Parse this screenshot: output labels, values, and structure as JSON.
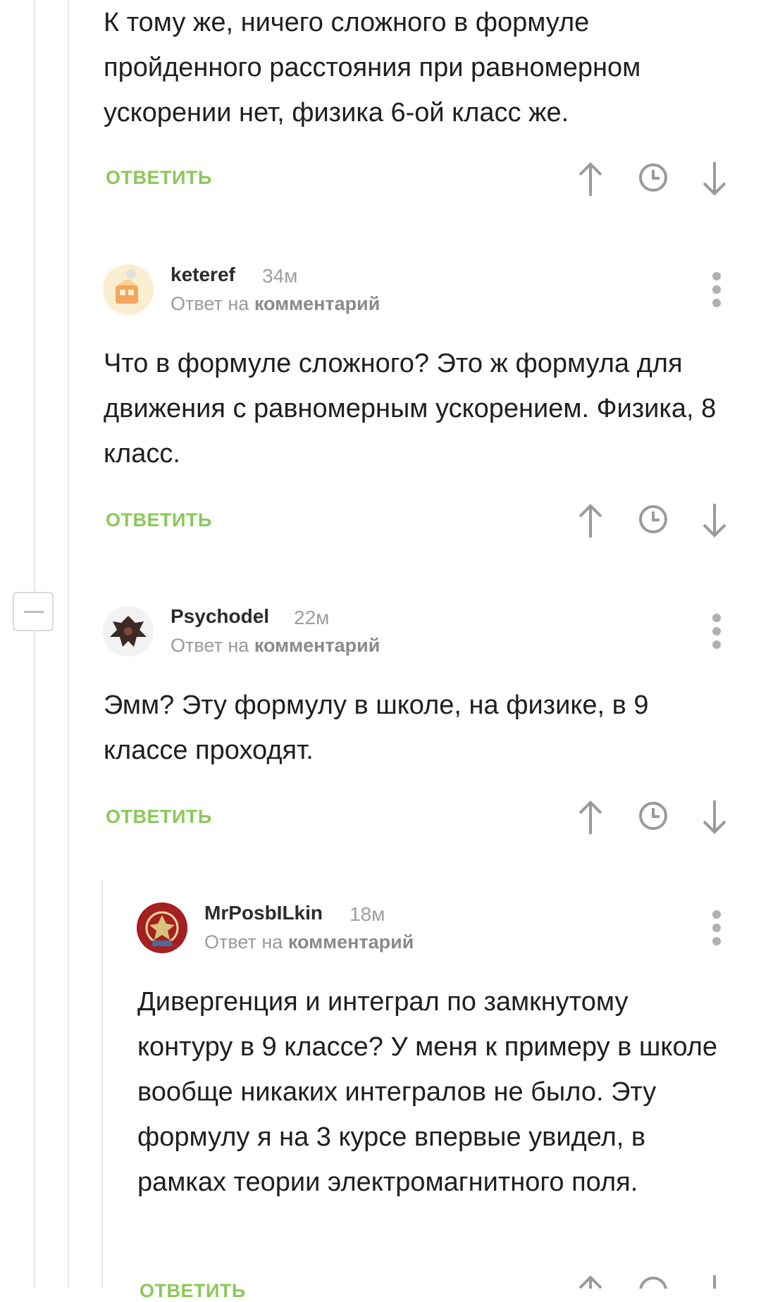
{
  "reply_label": "ОТВЕТИТЬ",
  "reply_to_prefix": "Ответ на",
  "reply_to_link": "комментарий",
  "accent_color": "#8ac858",
  "icons": [
    "arrow-up-icon",
    "clock-icon",
    "arrow-down-icon",
    "more-vertical-icon",
    "collapse-icon"
  ],
  "comments": [
    {
      "text": "К тому же, ничего сложного в формуле пройденного расстояния при равномерном ускорении нет, физика 6-ой класс же."
    },
    {
      "username": "keteref",
      "time": "34м",
      "text": "Что в формуле сложного? Это ж формула для движения с равномерным ускорением. Физика, 8 класс."
    },
    {
      "username": "Psychodel",
      "time": "22м",
      "text": "Эмм? Эту формулу в школе, на физике, в 9 классе проходят."
    },
    {
      "username": "MrPosbILkin",
      "time": "18м",
      "text": "Дивергенция и интеграл по замкнутому контуру в 9 классе? У меня к примеру в школе вообще никаких интегралов не было. Эту формулу я на 3 курсе впервые увидел, в рамках теории электромагнитного поля."
    }
  ]
}
